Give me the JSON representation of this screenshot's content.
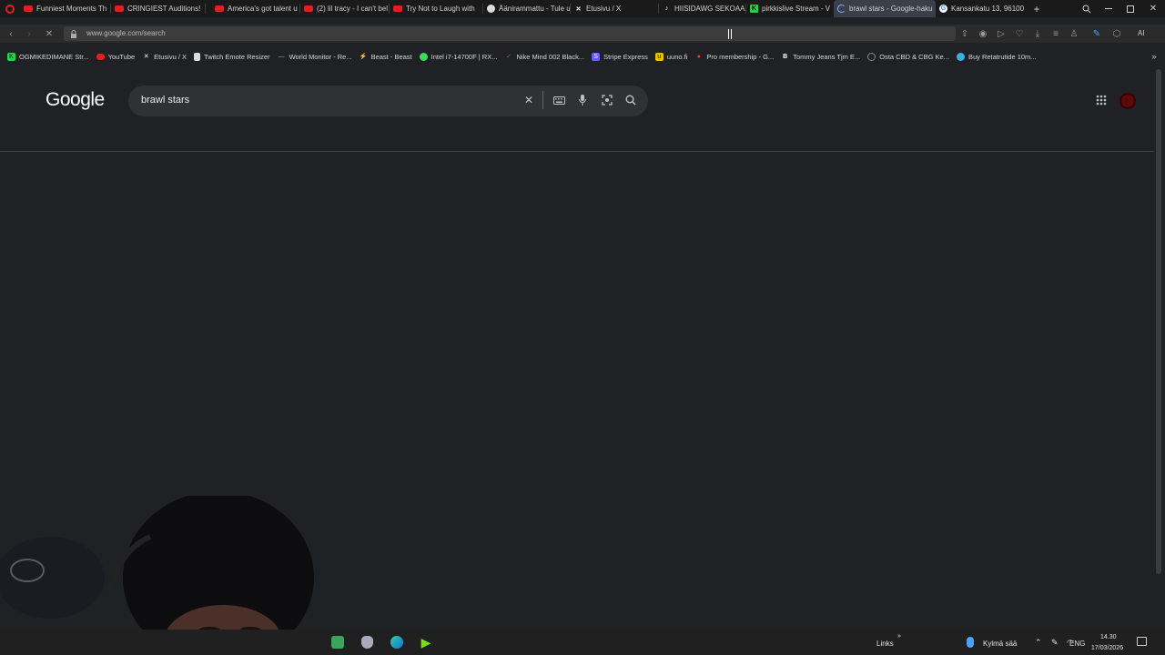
{
  "browser": {
    "tabs": [
      {
        "label": "Funniest Moments Th",
        "icon": "youtube-icon"
      },
      {
        "label": "CRINGIEST Auditions!",
        "icon": "youtube-icon"
      },
      {
        "label": "America's got talent u",
        "icon": "youtube-icon"
      },
      {
        "label": "(2) lil tracy - I can't bel",
        "icon": "youtube-icon"
      },
      {
        "label": "Try Not to Laugh with",
        "icon": "youtube-icon"
      },
      {
        "label": "Äänirammattu - Tule u",
        "icon": "globe-icon"
      },
      {
        "label": "Etusivu / X",
        "icon": "x-icon"
      },
      {
        "label": "HIISIDAWG SEKOAA #",
        "icon": "tiktok-icon"
      },
      {
        "label": "pirkkislive Stream - V",
        "icon": "kick-icon"
      },
      {
        "label": "brawl stars - Google-haku",
        "icon": "loading-icon",
        "active": true
      },
      {
        "label": "Kansankatu 13, 96100",
        "icon": "maps-icon"
      }
    ],
    "new_tab_label": "+",
    "address": "www.google.com/search",
    "extension_label": "AI",
    "bookmarks": [
      {
        "label": "OGMIKEDIMANE Str...",
        "icon": "kick-icon"
      },
      {
        "label": "YouTube",
        "icon": "youtube-icon"
      },
      {
        "label": "Etusivu / X",
        "icon": "x-icon"
      },
      {
        "label": "Twitch Emote Resizer",
        "icon": "page-icon"
      },
      {
        "label": "World Monitor - Re...",
        "icon": "monitor-icon"
      },
      {
        "label": "Beast - Beast",
        "icon": "beast-icon"
      },
      {
        "label": "Intel i7-14700F | RX...",
        "icon": "globe-icon"
      },
      {
        "label": "Nike Mind 002 Black...",
        "icon": "nike-icon"
      },
      {
        "label": "Stripe Express",
        "icon": "stripe-icon"
      },
      {
        "label": "uuno.fi",
        "icon": "uuno-icon"
      },
      {
        "label": "Pro membership - G...",
        "icon": "pin-icon"
      },
      {
        "label": "Tommy Jeans Tjm E...",
        "icon": "bold-icon"
      },
      {
        "label": "Osta CBD & CBG Ke...",
        "icon": "circle-icon"
      },
      {
        "label": "Buy Retatrutide 10m...",
        "icon": "drop-icon"
      }
    ]
  },
  "google": {
    "logo": "Google",
    "query": "brawl stars"
  },
  "taskbar": {
    "links_label": "Links",
    "weather": "Kylmä sää",
    "language": "ENG",
    "time": "14.30",
    "date": "17/03/2026"
  },
  "colors": {
    "page_bg": "#202124",
    "search_bg": "#303134",
    "active_tab": "#3a3f4a"
  }
}
